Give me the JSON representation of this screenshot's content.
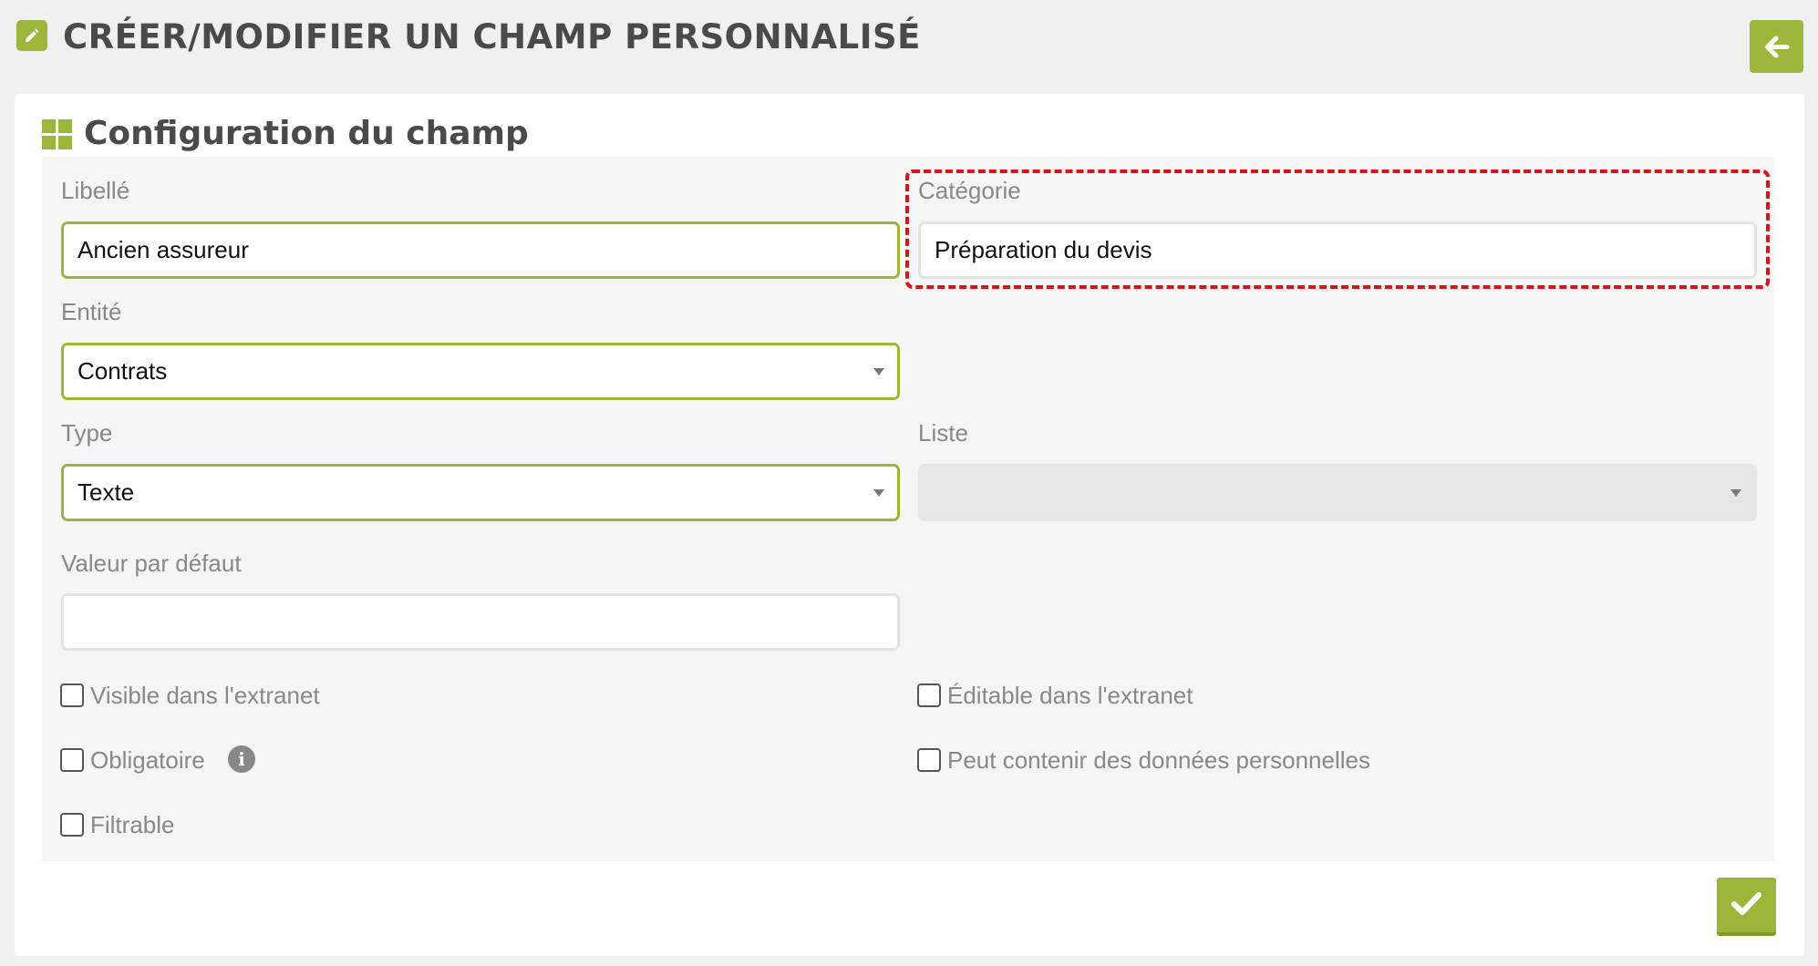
{
  "header": {
    "title": "CRÉER/MODIFIER UN CHAMP PERSONNALISÉ",
    "title_icon": "edit-icon",
    "back_icon": "arrow-left-icon"
  },
  "panel": {
    "title": "Configuration du champ",
    "icon": "grid-icon"
  },
  "form": {
    "libelle": {
      "label": "Libellé",
      "value": "Ancien assureur"
    },
    "categorie": {
      "label": "Catégorie",
      "value": "Préparation du devis"
    },
    "entite": {
      "label": "Entité",
      "value": "Contrats"
    },
    "type": {
      "label": "Type",
      "value": "Texte"
    },
    "liste": {
      "label": "Liste",
      "value": ""
    },
    "valeur_defaut": {
      "label": "Valeur par défaut",
      "value": ""
    },
    "checkboxes": {
      "visible_extranet": {
        "label": "Visible dans l'extranet",
        "checked": false
      },
      "editable_extranet": {
        "label": "Éditable dans l'extranet",
        "checked": false
      },
      "obligatoire": {
        "label": "Obligatoire",
        "checked": false
      },
      "donnees_personnelles": {
        "label": "Peut contenir des données personnelles",
        "checked": false
      },
      "filtrable": {
        "label": "Filtrable",
        "checked": false
      }
    },
    "info_icon": "i"
  },
  "actions": {
    "save_icon": "checkmark-icon"
  },
  "colors": {
    "accent": "#9bb73a",
    "highlight": "#d8111b",
    "background": "#f0f0f0"
  }
}
